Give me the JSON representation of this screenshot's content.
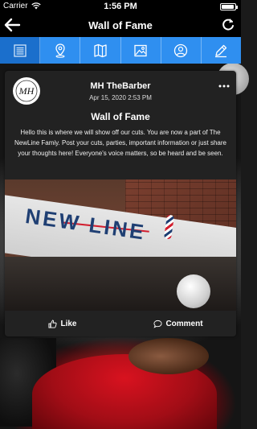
{
  "status_bar": {
    "carrier": "Carrier",
    "time": "1:56 PM",
    "battery_level": 0.95
  },
  "header": {
    "title": "Wall of Fame",
    "back_icon": "back-arrow-icon",
    "refresh_icon": "refresh-icon"
  },
  "tabs": [
    {
      "icon": "list-icon",
      "active": true
    },
    {
      "icon": "location-pin-icon",
      "active": false
    },
    {
      "icon": "map-icon",
      "active": false
    },
    {
      "icon": "photo-icon",
      "active": false
    },
    {
      "icon": "person-circle-icon",
      "active": false
    },
    {
      "icon": "pen-icon",
      "active": false
    }
  ],
  "post": {
    "avatar_logo_text": "MH",
    "author": "MH TheBarber",
    "date": "Apr 15, 2020 2:53 PM",
    "title": "Wall of Fame",
    "body": "Hello this is where we will show off our cuts. You are now a part of The NewLine Famiy. Post your cuts, parties, important information or just share your thoughts here! Everyone's voice matters, so be heard and be seen.",
    "image_sign_text": "NEW LINE",
    "like_label": "Like",
    "comment_label": "Comment"
  },
  "colors": {
    "tab_bar": "#2f8ff0",
    "tab_active": "#1b6fcc",
    "header_bg": "#000000",
    "card_bg": "#222222"
  }
}
